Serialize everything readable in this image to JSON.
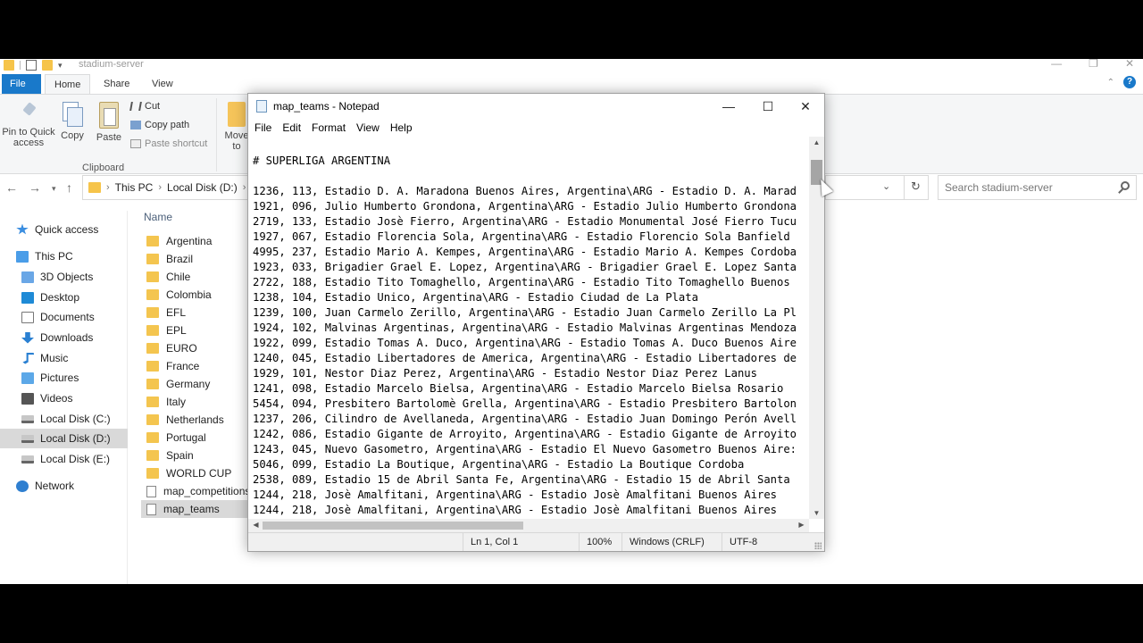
{
  "explorer": {
    "title": "stadium-server",
    "tabs": [
      "File",
      "Home",
      "Share",
      "View"
    ],
    "ribbon": {
      "pin_label": "Pin to Quick access",
      "copy_label": "Copy",
      "paste_label": "Paste",
      "cut_label": "Cut",
      "copy_path_label": "Copy path",
      "paste_shortcut_label": "Paste shortcut",
      "group_clipboard": "Clipboard",
      "move_label": "Move to"
    },
    "address": {
      "this_pc": "This PC",
      "local_disk": "Local Disk (D:)"
    },
    "search_placeholder": "Search stadium-server",
    "nav": [
      {
        "label": "Quick access",
        "icon": "star-icon"
      },
      {
        "label": "This PC",
        "icon": "computer-icon"
      },
      {
        "label": "3D Objects",
        "icon": "cube-icon"
      },
      {
        "label": "Desktop",
        "icon": "desktop-icon"
      },
      {
        "label": "Documents",
        "icon": "document-icon"
      },
      {
        "label": "Downloads",
        "icon": "download-icon"
      },
      {
        "label": "Music",
        "icon": "music-icon"
      },
      {
        "label": "Pictures",
        "icon": "picture-icon"
      },
      {
        "label": "Videos",
        "icon": "video-icon"
      },
      {
        "label": "Local Disk (C:)",
        "icon": "drive-icon"
      },
      {
        "label": "Local Disk (D:)",
        "icon": "drive-icon"
      },
      {
        "label": "Local Disk (E:)",
        "icon": "drive-icon"
      },
      {
        "label": "Network",
        "icon": "network-icon"
      }
    ],
    "column_name": "Name",
    "files": [
      "Argentina",
      "Brazil",
      "Chile",
      "Colombia",
      "EFL",
      "EPL",
      "EURO",
      "France",
      "Germany",
      "Italy",
      "Netherlands",
      "Portugal",
      "Spain",
      "WORLD CUP",
      "map_competitions",
      "map_teams"
    ]
  },
  "notepad": {
    "title": "map_teams - Notepad",
    "menu": [
      "File",
      "Edit",
      "Format",
      "View",
      "Help"
    ],
    "lines": [
      "",
      "# SUPERLIGA ARGENTINA",
      "",
      "1236, 113, Estadio D. A. Maradona Buenos Aires, Argentina\\ARG - Estadio D. A. Marad",
      "1921, 096, Julio Humberto Grondona, Argentina\\ARG - Estadio Julio Humberto Grondona",
      "2719, 133, Estadio Josè Fierro, Argentina\\ARG - Estadio Monumental José Fierro Tucu",
      "1927, 067, Estadio Florencia Sola, Argentina\\ARG - Estadio Florencio Sola Banfield",
      "4995, 237, Estadio Mario A. Kempes, Argentina\\ARG - Estadio Mario A. Kempes Cordoba",
      "1923, 033, Brigadier Grael E. Lopez, Argentina\\ARG - Brigadier Grael E. Lopez Santa",
      "2722, 188, Estadio Tito Tomaghello, Argentina\\ARG - Estadio Tito Tomaghello Buenos",
      "1238, 104, Estadio Unico, Argentina\\ARG - Estadio Ciudad de La Plata",
      "1239, 100, Juan Carmelo Zerillo, Argentina\\ARG - Estadio Juan Carmelo Zerillo La Pl",
      "1924, 102, Malvinas Argentinas, Argentina\\ARG - Estadio Malvinas Argentinas Mendoza",
      "1922, 099, Estadio Tomas A. Duco, Argentina\\ARG - Estadio Tomas A. Duco Buenos Aire",
      "1240, 045, Estadio Libertadores de America, Argentina\\ARG - Estadio Libertadores de",
      "1929, 101, Nestor Diaz Perez, Argentina\\ARG - Estadio Nestor Diaz Perez Lanus",
      "1241, 098, Estadio Marcelo Bielsa, Argentina\\ARG - Estadio Marcelo Bielsa Rosario",
      "5454, 094, Presbitero Bartolomè Grella, Argentina\\ARG - Estadio Presbitero Bartolon",
      "1237, 206, Cilindro de Avellaneda, Argentina\\ARG - Estadio Juan Domingo Perón Avell",
      "1242, 086, Estadio Gigante de Arroyito, Argentina\\ARG - Estadio Gigante de Arroyito",
      "1243, 045, Nuevo Gasometro, Argentina\\ARG - Estadio El Nuevo Gasometro Buenos Aire:",
      "5046, 099, Estadio La Boutique, Argentina\\ARG - Estadio La Boutique Cordoba",
      "2538, 089, Estadio 15 de Abril Santa Fe, Argentina\\ARG - Estadio 15 de Abril Santa",
      "1244, 218, Josè Amalfitani, Argentina\\ARG - Estadio Josè Amalfitani Buenos Aires",
      "1244, 218, Josè Amalfitani, Argentina\\ARG - Estadio Josè Amalfitani Buenos Aires"
    ],
    "status": {
      "position": "Ln 1, Col 1",
      "zoom": "100%",
      "line_ending": "Windows (CRLF)",
      "encoding": "UTF-8"
    }
  },
  "colors": {
    "accent": "#1979ca",
    "selection": "#d9d9d9",
    "folder": "#f4c54f"
  }
}
